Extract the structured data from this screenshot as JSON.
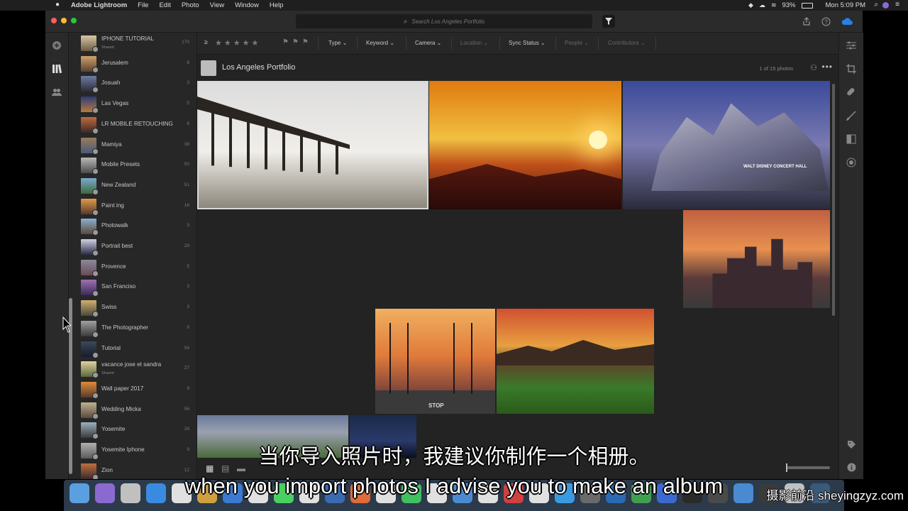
{
  "menubar": {
    "app_name": "Adobe Lightroom",
    "menus": [
      "File",
      "Edit",
      "Photo",
      "View",
      "Window",
      "Help"
    ],
    "battery": "93%",
    "clock": "Mon 5:09 PM"
  },
  "search": {
    "placeholder": "Search Los Angeles Portfolio"
  },
  "filterbar": {
    "rating_operator": "≥",
    "stars": "★★★★★",
    "flags": "⚑⚑⚑",
    "dropdowns": [
      {
        "label": "Type",
        "enabled": true
      },
      {
        "label": "Keyword",
        "enabled": true
      },
      {
        "label": "Camera",
        "enabled": true
      },
      {
        "label": "Location",
        "enabled": false
      },
      {
        "label": "Sync Status",
        "enabled": true
      },
      {
        "label": "People",
        "enabled": false
      },
      {
        "label": "Contributors",
        "enabled": false
      }
    ]
  },
  "album_header": {
    "title": "Los Angeles Portfolio",
    "count": "1 of 15 photos"
  },
  "albums": [
    {
      "name": "IPHONE TUTORIAL",
      "sub": "Shared",
      "count": "170",
      "colors": [
        "#d8c9a3",
        "#6a5a43"
      ]
    },
    {
      "name": "Jerusalem",
      "count": "8",
      "colors": [
        "#cfa36b",
        "#5c4030"
      ]
    },
    {
      "name": "Josuah",
      "count": "3",
      "colors": [
        "#6b7da0",
        "#2c2c3a"
      ]
    },
    {
      "name": "Las Vegas",
      "count": "5",
      "colors": [
        "#2c3c78",
        "#b87a3a"
      ]
    },
    {
      "name": "LR MOBILE RETOUCHING",
      "count": "8",
      "colors": [
        "#c06a3c",
        "#3a2a2a"
      ]
    },
    {
      "name": "Mamiya",
      "count": "38",
      "colors": [
        "#9a7a5c",
        "#4a5a7a"
      ]
    },
    {
      "name": "Mobile Presets",
      "count": "50",
      "colors": [
        "#b8b8b8",
        "#4c4c4c"
      ]
    },
    {
      "name": "New Zealand",
      "count": "51",
      "colors": [
        "#7aaad0",
        "#3c6a3c"
      ]
    },
    {
      "name": "Paint ing",
      "count": "16",
      "colors": [
        "#e09a4a",
        "#5a3a2a"
      ]
    },
    {
      "name": "Photowalk",
      "count": "3",
      "colors": [
        "#8ab0d0",
        "#5a4a3a"
      ]
    },
    {
      "name": "Portrait best",
      "count": "28",
      "colors": [
        "#d0d0e0",
        "#2a2a4a"
      ]
    },
    {
      "name": "Provence",
      "count": "5",
      "colors": [
        "#8a8a9a",
        "#6a4a5a"
      ]
    },
    {
      "name": "San Franciso",
      "count": "3",
      "colors": [
        "#a070b0",
        "#3a2a5a"
      ]
    },
    {
      "name": "Swiss",
      "count": "3",
      "colors": [
        "#d0b070",
        "#4a4a3a"
      ]
    },
    {
      "name": "The Photographer",
      "count": "8",
      "colors": [
        "#a0a0a0",
        "#3a3a3a"
      ]
    },
    {
      "name": "Tutorial",
      "count": "54",
      "colors": [
        "#3a4a5a",
        "#1a1a2a"
      ]
    },
    {
      "name": "vacance jose et sandra",
      "sub": "Shared",
      "count": "27",
      "colors": [
        "#e0d0a0",
        "#5a6a3a"
      ]
    },
    {
      "name": "Wall paper 2017",
      "count": "9",
      "colors": [
        "#e08a3a",
        "#5a3a2a"
      ]
    },
    {
      "name": "Wedding Micka",
      "count": "56",
      "colors": [
        "#c0b090",
        "#5a4a3a"
      ]
    },
    {
      "name": "Yosemite",
      "count": "28",
      "colors": [
        "#9ab0c0",
        "#3a3a3a"
      ]
    },
    {
      "name": "Yosemite Iphone",
      "count": "9",
      "colors": [
        "#b0b0b0",
        "#5a5a5a"
      ]
    },
    {
      "name": "Zion",
      "count": "12",
      "colors": [
        "#c07040",
        "#3a2a2a"
      ]
    }
  ],
  "photos": [
    {
      "subject": "pier",
      "selected": true,
      "colors": [
        "#dcdcdc",
        "#f0eeea",
        "#8a8478"
      ]
    },
    {
      "subject": "sunset-city",
      "selected": false,
      "colors": [
        "#e8a020",
        "#f0c040",
        "#3a1a10"
      ]
    },
    {
      "subject": "disney-hall",
      "selected": false,
      "colors": [
        "#3a4a9a",
        "#8a8aaa",
        "#2a2a3a"
      ],
      "sign": "WALT DISNEY CONCERT HALL"
    },
    {
      "subject": "downtown-la",
      "selected": false,
      "colors": [
        "#c06040",
        "#e89050",
        "#3a3a3a"
      ]
    },
    {
      "subject": "palm-street",
      "selected": false,
      "colors": [
        "#e07a3a",
        "#f0a050",
        "#2a2a2a"
      ],
      "sign": "STOP"
    },
    {
      "subject": "green-hills",
      "selected": false,
      "colors": [
        "#d05030",
        "#e8a040",
        "#3a7a2a"
      ]
    },
    {
      "subject": "tree-dusk",
      "selected": false,
      "colors": [
        "#6a7a9a",
        "#4a6a3a",
        "#2a3a4a"
      ]
    },
    {
      "subject": "night-sky",
      "selected": false,
      "colors": [
        "#1a2a4a",
        "#2a3a6a",
        "#0a1020"
      ]
    }
  ],
  "subtitles": {
    "cn": "当你导入照片时，我建议你制作一个相册。",
    "en": "when you import photos I advise you to make an album",
    "watermark": "摄影前沿 sheyingzyz.com"
  },
  "dock_colors": [
    "#5aa0e0",
    "#8a6ad0",
    "#c0c0c0",
    "#3a8ae0",
    "#e0e0e0",
    "#d0a040",
    "#3a7ad0",
    "#e0e0e0",
    "#4ad060",
    "#e0e0e0",
    "#3a6ab0",
    "#e06a3a",
    "#e0e0e0",
    "#40c060",
    "#e0e0e0",
    "#4a8ad0",
    "#e0e0e0",
    "#d04040",
    "#e0e0e0",
    "#3a9ae0",
    "#6a6a6a",
    "#2a6ab0",
    "#40a050",
    "#3a6ad0",
    "#2a2a2a",
    "#4a4a4a",
    "#4a8ad0",
    "#3a3a3a",
    "#c0c0c0",
    "#3a5a7a"
  ],
  "colors": {
    "accent": "#2680eb",
    "panel": "#272727",
    "bg": "#232323"
  }
}
